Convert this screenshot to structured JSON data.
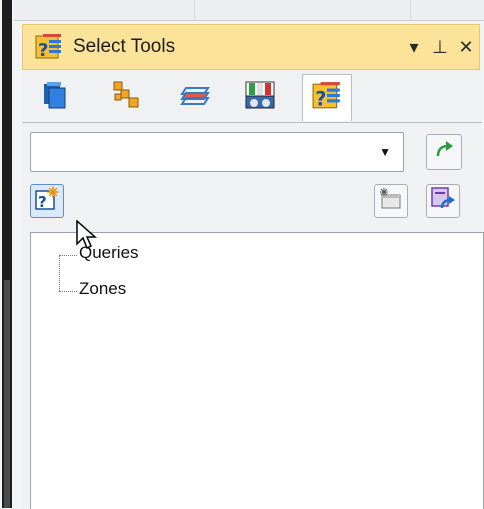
{
  "panel": {
    "title": "Select Tools",
    "controls": {
      "dropdown_glyph": "▾",
      "pin_glyph": "⊥",
      "close_glyph": "✕"
    }
  },
  "tabs": [
    {
      "icon": "copy-pages-icon"
    },
    {
      "icon": "assembly-tree-icon"
    },
    {
      "icon": "layers-icon"
    },
    {
      "icon": "dashboard-icon"
    },
    {
      "icon": "select-tools-icon",
      "active": true
    }
  ],
  "query_combo": {
    "value": ""
  },
  "toolbar": {
    "left": [
      "new-query-icon"
    ],
    "right": [
      "new-zone-icon",
      "apply-query-icon"
    ]
  },
  "tree": {
    "items": [
      "Queries",
      "Zones"
    ]
  },
  "colors": {
    "titlebar_bg": "#fbe49a",
    "panel_bg": "#f0f1f3",
    "tree_bg": "#ffffff"
  }
}
